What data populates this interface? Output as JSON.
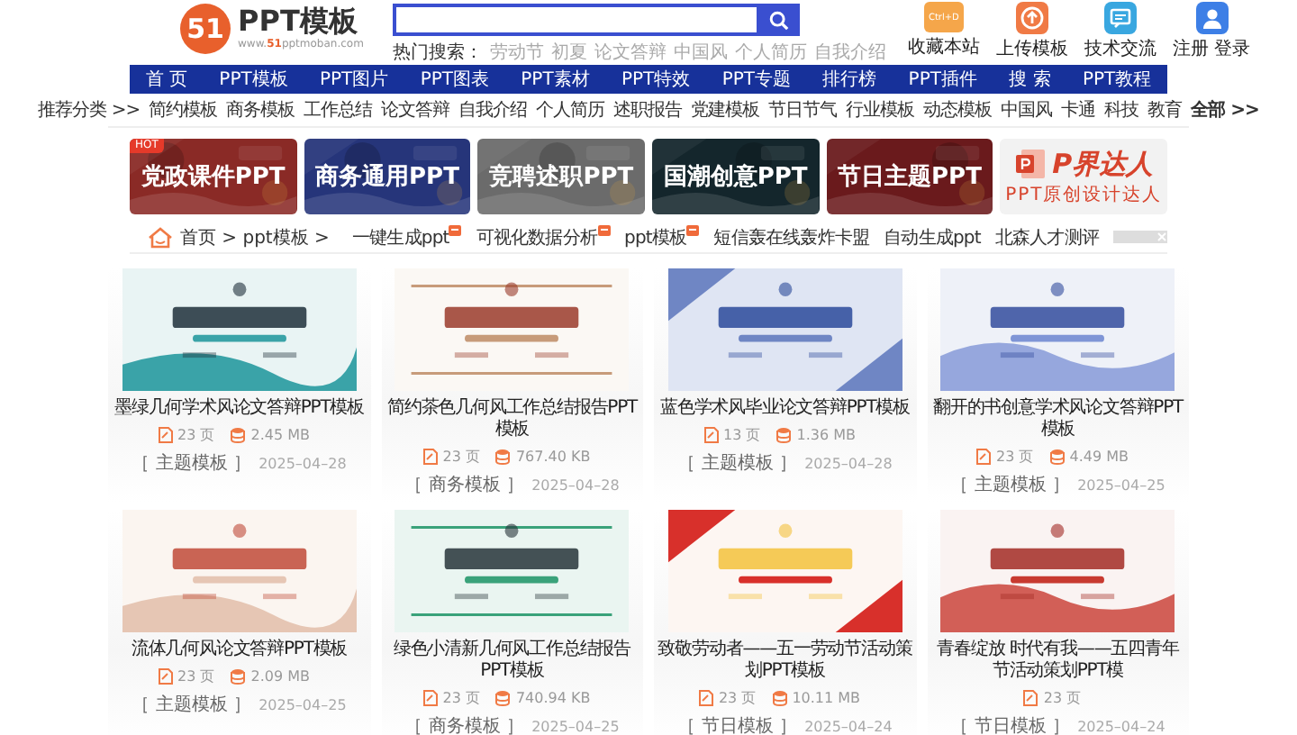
{
  "header": {
    "logo_mark": "51",
    "logo_title": "PPT模板",
    "logo_url": [
      "www.",
      "51",
      "pptmoban.com"
    ],
    "hot_label": "热门搜索：",
    "hot_searches": [
      "劳动节",
      "初夏",
      "论文答辩",
      "中国风",
      "个人简历",
      "自我介绍"
    ],
    "links": [
      {
        "kind": "folder",
        "icon_text": "Ctrl+D",
        "label": "收藏本站"
      },
      {
        "kind": "upload",
        "label": "上传模板"
      },
      {
        "kind": "chat",
        "label": "技术交流"
      },
      {
        "kind": "user",
        "label": "注册 登录"
      }
    ]
  },
  "nav": [
    "首 页",
    "PPT模板",
    "PPT图片",
    "PPT图表",
    "PPT素材",
    "PPT特效",
    "PPT专题",
    "排行榜",
    "PPT插件",
    "搜 索",
    "PPT教程"
  ],
  "categories": {
    "label": "推荐分类 >>",
    "items": [
      "简约模板",
      "商务模板",
      "工作总结",
      "论文答辩",
      "自我介绍",
      "个人简历",
      "述职报告",
      "党建模板",
      "节日节气",
      "行业模板",
      "动态模板",
      "中国风",
      "卡通",
      "科技",
      "教育"
    ],
    "more": "全部 >>"
  },
  "banners": [
    {
      "kind": "label",
      "label": "党政课件PPT",
      "hot": "HOT"
    },
    {
      "kind": "label",
      "label": "商务通用PPT"
    },
    {
      "kind": "label",
      "label": "竞聘述职PPT"
    },
    {
      "kind": "label",
      "label": "国潮创意PPT"
    },
    {
      "kind": "label",
      "label": "节日主题PPT"
    },
    {
      "kind": "brand",
      "label": "P界达人",
      "subtitle": "PPT原创设计达人"
    }
  ],
  "breadcrumb": "首页 > ppt模板 >",
  "ad_links": [
    {
      "label": "一键生成ppt",
      "ad_mark": true
    },
    {
      "label": "可视化数据分析",
      "ad_mark": true
    },
    {
      "label": "ppt模板",
      "ad_mark": true
    },
    {
      "label": "短信轰在线轰炸卡盟",
      "ad_mark": false
    },
    {
      "label": "自动生成ppt",
      "ad_mark": false
    },
    {
      "label": "北森人才测评",
      "ad_mark": false
    }
  ],
  "cards": [
    {
      "title": "墨绿几何学术风论文答辩PPT模板",
      "pages": "23 页",
      "size": "2.45 MB",
      "tag": "［ 主题模板 ］",
      "date": "2025–04–28"
    },
    {
      "title": "简约茶色几何风工作总结报告PPT模板",
      "pages": "23 页",
      "size": "767.40 KB",
      "tag": "［ 商务模板 ］",
      "date": "2025–04–28"
    },
    {
      "title": "蓝色学术风毕业论文答辩PPT模板",
      "pages": "13 页",
      "size": "1.36 MB",
      "tag": "［ 主题模板 ］",
      "date": "2025–04–28"
    },
    {
      "title": "翻开的书创意学术风论文答辩PPT模板",
      "pages": "23 页",
      "size": "4.49 MB",
      "tag": "［ 主题模板 ］",
      "date": "2025–04–25"
    },
    {
      "title": "流体几何风论文答辩PPT模板",
      "pages": "23 页",
      "size": "2.09 MB",
      "tag": "［ 主题模板 ］",
      "date": "2025–04–25"
    },
    {
      "title": "绿色小清新几何风工作总结报告PPT模板",
      "pages": "23 页",
      "size": "740.94 KB",
      "tag": "［ 商务模板 ］",
      "date": "2025–04–25"
    },
    {
      "title": "致敬劳动者——五一劳动节活动策划PPT模板",
      "pages": "23 页",
      "size": "10.11 MB",
      "tag": "［ 节日模板 ］",
      "date": "2025–04–24"
    },
    {
      "title": "青春绽放 时代有我——五四青年节活动策划PPT模",
      "pages": "23 页",
      "tag": "［ 节日模板 ］",
      "date": "2025–04–24"
    }
  ]
}
